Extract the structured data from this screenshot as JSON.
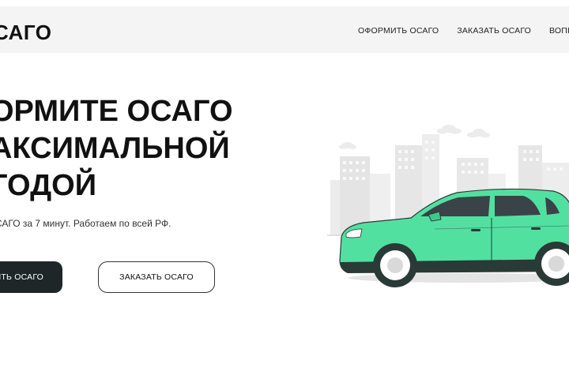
{
  "header": {
    "logo": "САГО",
    "nav": [
      {
        "label": "ОФОРМИТЬ ОСАГО"
      },
      {
        "label": "ЗАКАЗАТЬ ОСАГО"
      },
      {
        "label": "ВОПР"
      }
    ]
  },
  "hero": {
    "title_lines": [
      "ОРМИТЕ ОСАГО",
      "АКСИМАЛЬНОЙ",
      "ГОДОЙ"
    ],
    "subtitle": "САГО за 7 минут. Работаем по всей РФ.",
    "primary_button": "ИТЬ ОСАГО",
    "secondary_button": "ЗАКАЗАТЬ ОСАГО"
  },
  "colors": {
    "header_bg": "#f4f4f4",
    "primary_button_bg": "#1f2628",
    "car_body": "#52e0a0",
    "city_gray": "#e8e8e8"
  },
  "icons": {
    "illustration": "car-city-illustration"
  }
}
